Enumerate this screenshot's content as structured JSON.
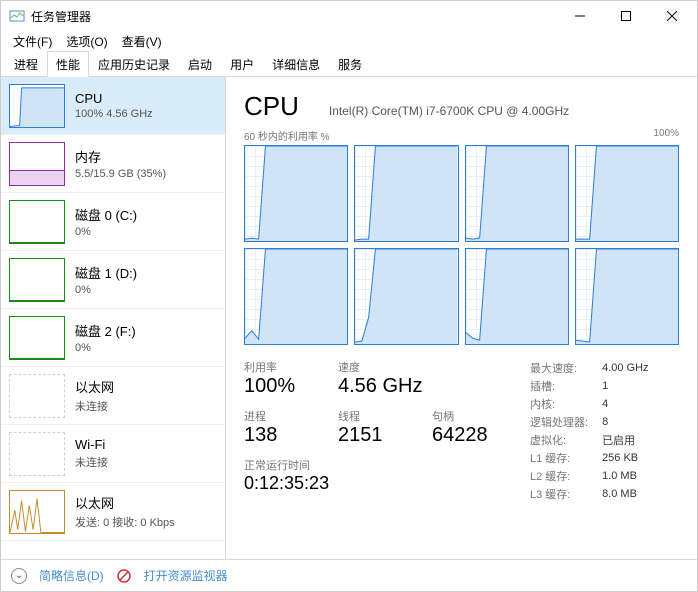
{
  "window": {
    "title": "任务管理器"
  },
  "menu": {
    "file": "文件(F)",
    "options": "选项(O)",
    "view": "查看(V)"
  },
  "tabs": {
    "process": "进程",
    "performance": "性能",
    "history": "应用历史记录",
    "startup": "启动",
    "users": "用户",
    "details": "详细信息",
    "services": "服务"
  },
  "sidebar": [
    {
      "id": "cpu",
      "title": "CPU",
      "sub": "100%  4.56 GHz",
      "color": "#2e7cd6",
      "kind": "cpu",
      "selected": true
    },
    {
      "id": "memory",
      "title": "内存",
      "sub": "5.5/15.9 GB (35%)",
      "color": "#8a2da5",
      "kind": "mem"
    },
    {
      "id": "disk0",
      "title": "磁盘 0 (C:)",
      "sub": "0%",
      "color": "#1a8a1a",
      "kind": "disk"
    },
    {
      "id": "disk1",
      "title": "磁盘 1 (D:)",
      "sub": "0%",
      "color": "#1a8a1a",
      "kind": "disk"
    },
    {
      "id": "disk2",
      "title": "磁盘 2 (F:)",
      "sub": "0%",
      "color": "#1a8a1a",
      "kind": "disk"
    },
    {
      "id": "eth0",
      "title": "以太网",
      "sub": "未连接",
      "color": "#cfcfcf",
      "kind": "net-off"
    },
    {
      "id": "wifi",
      "title": "Wi-Fi",
      "sub": "未连接",
      "color": "#cfcfcf",
      "kind": "net-off"
    },
    {
      "id": "eth1",
      "title": "以太网",
      "sub": "发送: 0 接收: 0 Kbps",
      "color": "#c38b2a",
      "kind": "net-on"
    }
  ],
  "main": {
    "title": "CPU",
    "model": "Intel(R) Core(TM) i7-6700K CPU @ 4.00GHz",
    "graphLabelLeft": "60 秒内的利用率 %",
    "graphLabelRight": "100%"
  },
  "stats": {
    "util_lbl": "利用率",
    "util_val": "100%",
    "speed_lbl": "速度",
    "speed_val": "4.56 GHz",
    "proc_lbl": "进程",
    "proc_val": "138",
    "thr_lbl": "线程",
    "thr_val": "2151",
    "hnd_lbl": "句柄",
    "hnd_val": "64228",
    "up_lbl": "正常运行时间",
    "up_val": "0:12:35:23"
  },
  "specs": {
    "max_lbl": "最大速度:",
    "max_val": "4.00 GHz",
    "sock_lbl": "插槽:",
    "sock_val": "1",
    "core_lbl": "内核:",
    "core_val": "4",
    "lp_lbl": "逻辑处理器:",
    "lp_val": "8",
    "virt_lbl": "虚拟化:",
    "virt_val": "已启用",
    "l1_lbl": "L1 缓存:",
    "l1_val": "256 KB",
    "l2_lbl": "L2 缓存:",
    "l2_val": "1.0 MB",
    "l3_lbl": "L3 缓存:",
    "l3_val": "8.0 MB"
  },
  "footer": {
    "fewer": "简略信息(D)",
    "resmon": "打开资源监视器"
  },
  "chart_data": {
    "type": "line",
    "cores": 8,
    "series_per_core": [
      [
        2,
        3,
        2,
        100,
        100,
        100,
        100,
        100,
        100,
        100,
        100,
        100,
        100,
        100,
        100,
        100
      ],
      [
        1,
        2,
        2,
        100,
        100,
        100,
        100,
        100,
        100,
        100,
        100,
        100,
        100,
        100,
        100,
        100
      ],
      [
        3,
        2,
        3,
        100,
        100,
        100,
        100,
        100,
        100,
        100,
        100,
        100,
        100,
        100,
        100,
        100
      ],
      [
        2,
        2,
        2,
        100,
        100,
        100,
        100,
        100,
        100,
        100,
        100,
        100,
        100,
        100,
        100,
        100
      ],
      [
        6,
        14,
        5,
        100,
        100,
        100,
        100,
        100,
        100,
        100,
        100,
        100,
        100,
        100,
        100,
        100
      ],
      [
        2,
        3,
        28,
        100,
        100,
        100,
        100,
        100,
        100,
        100,
        100,
        100,
        100,
        100,
        100,
        100
      ],
      [
        12,
        6,
        4,
        100,
        100,
        100,
        100,
        100,
        100,
        100,
        100,
        100,
        100,
        100,
        100,
        100
      ],
      [
        4,
        3,
        2,
        100,
        100,
        100,
        100,
        100,
        100,
        100,
        100,
        100,
        100,
        100,
        100,
        100
      ]
    ],
    "ylim": [
      0,
      100
    ],
    "xrange_seconds": 60
  }
}
